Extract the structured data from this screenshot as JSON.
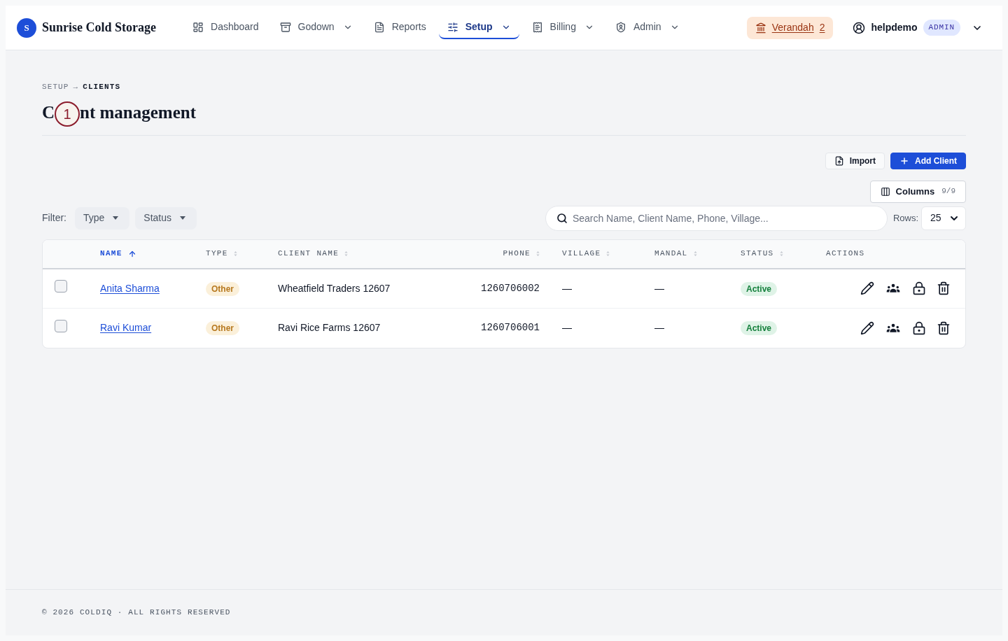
{
  "header": {
    "brand": {
      "logo_letter": "S",
      "name": "Sunrise Cold Storage"
    },
    "nav": [
      {
        "label": "Dashboard",
        "selected": false,
        "has_menu": false
      },
      {
        "label": "Godown",
        "selected": false,
        "has_menu": true
      },
      {
        "label": "Reports",
        "selected": false,
        "has_menu": false
      },
      {
        "label": "Setup",
        "selected": true,
        "has_menu": true
      },
      {
        "label": "Billing",
        "selected": false,
        "has_menu": true
      },
      {
        "label": "Admin",
        "selected": false,
        "has_menu": true
      }
    ],
    "location": {
      "label": "Verandah",
      "count": "2"
    },
    "user": {
      "name": "helpdemo",
      "role": "ADMIN"
    }
  },
  "breadcrumb": {
    "separator": "→",
    "items": [
      {
        "label": "SETUP",
        "current": false
      },
      {
        "label": "CLIENTS",
        "current": true
      }
    ]
  },
  "title": {
    "visible_parts": [
      "C",
      "nt management"
    ],
    "marker": "1"
  },
  "actions": [
    {
      "label": "Import",
      "kind": "secondary"
    },
    {
      "label": "Add Client",
      "kind": "primary"
    }
  ],
  "columns_button": {
    "label": "Columns",
    "count": "9/9"
  },
  "filter": {
    "label": "Filter:",
    "dropdowns": [
      "Type",
      "Status"
    ]
  },
  "search": {
    "placeholder": "Search Name, Client Name, Phone, Village..."
  },
  "rows_per_page": {
    "label": "Rows:",
    "value": "25"
  },
  "table": {
    "columns": [
      {
        "label": "NAME",
        "sortable": true,
        "sorted": true
      },
      {
        "label": "TYPE",
        "sortable": true,
        "sorted": false
      },
      {
        "label": "CLIENT NAME",
        "sortable": true,
        "sorted": false
      },
      {
        "label": "PHONE",
        "sortable": true,
        "sorted": false
      },
      {
        "label": "VILLAGE",
        "sortable": true,
        "sorted": false
      },
      {
        "label": "MANDAL",
        "sortable": true,
        "sorted": false
      },
      {
        "label": "STATUS",
        "sortable": true,
        "sorted": false
      },
      {
        "label": "ACTIONS",
        "sortable": false,
        "sorted": false
      }
    ],
    "rows": [
      {
        "selected": false,
        "name": "Anita Sharma",
        "type": "Other",
        "client_name": "Wheatfield Traders 12607",
        "phone": "1260706002",
        "village": "—",
        "mandal": "—",
        "status": "Active"
      },
      {
        "selected": false,
        "name": "Ravi Kumar",
        "type": "Other",
        "client_name": "Ravi Rice Farms 12607",
        "phone": "1260706001",
        "village": "—",
        "mandal": "—",
        "status": "Active"
      }
    ]
  },
  "footer": "© 2026 COLDIQ · ALL RIGHTS RESERVED"
}
